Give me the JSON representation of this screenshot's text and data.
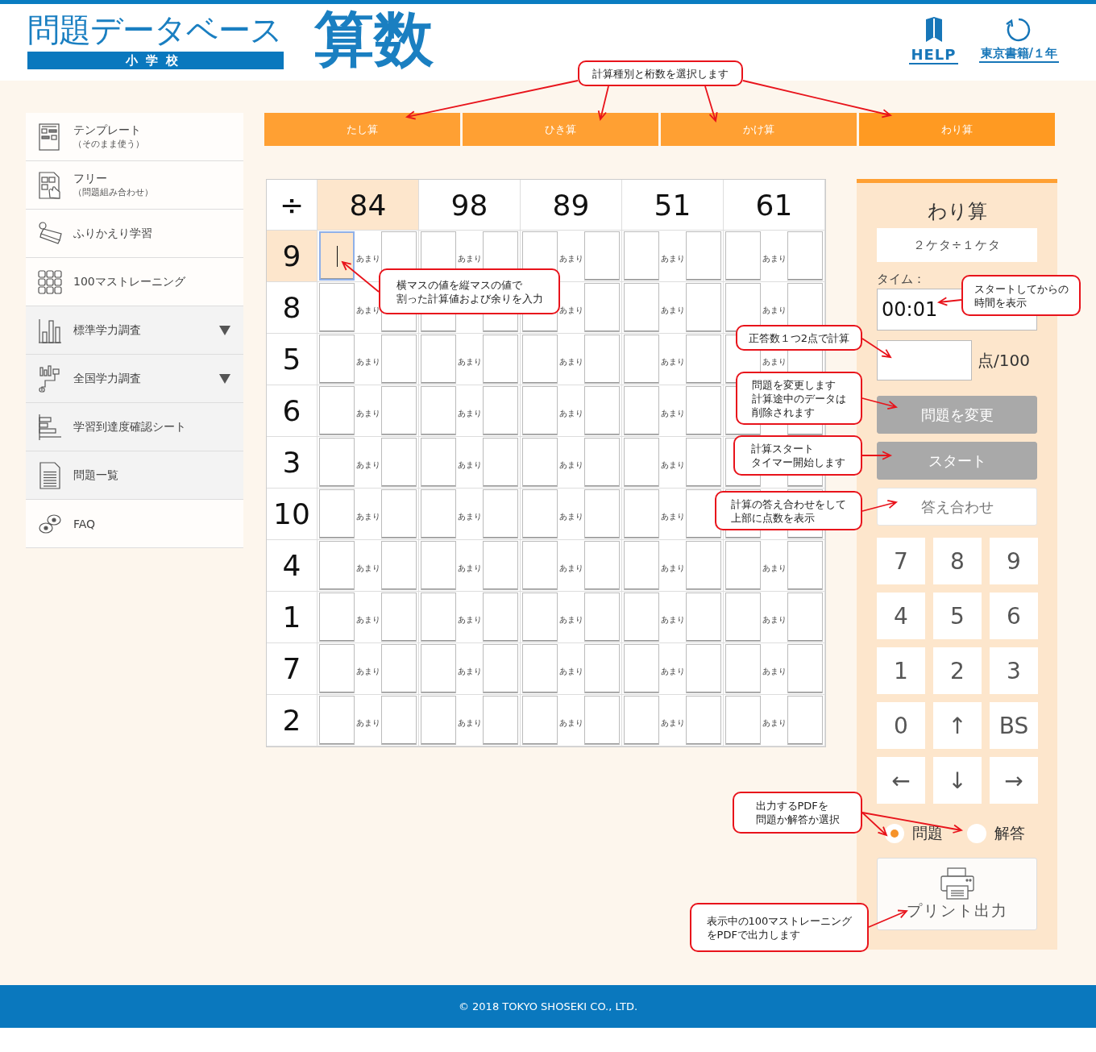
{
  "header": {
    "logo_title": "問題データベース",
    "logo_subtitle": "小学校",
    "subject": "算数",
    "help": {
      "label": "HELP"
    },
    "account": {
      "label": "東京書籍/１年"
    }
  },
  "sidebar": {
    "items": [
      {
        "label": "テンプレート",
        "sublabel": "（そのまま使う）",
        "shaded": false,
        "expandable": false
      },
      {
        "label": "フリー",
        "sublabel": "（問題組み合わせ）",
        "shaded": false,
        "expandable": false
      },
      {
        "label": "ふりかえり学習",
        "shaded": false,
        "expandable": false
      },
      {
        "label": "100マストレーニング",
        "shaded": false,
        "expandable": false
      },
      {
        "label": "標準学力調査",
        "shaded": true,
        "expandable": true
      },
      {
        "label": "全国学力調査",
        "shaded": true,
        "expandable": true
      },
      {
        "label": "学習到達度確認シート",
        "shaded": true,
        "expandable": false
      },
      {
        "label": "問題一覧",
        "shaded": true,
        "expandable": false
      },
      {
        "label": "FAQ",
        "shaded": false,
        "expandable": false
      }
    ]
  },
  "tabs": [
    {
      "label": "たし算",
      "selected": false
    },
    {
      "label": "ひき算",
      "selected": false
    },
    {
      "label": "かけ算",
      "selected": false
    },
    {
      "label": "わり算",
      "selected": true
    }
  ],
  "grid": {
    "operator": "÷",
    "columns": [
      {
        "value": "84",
        "highlighted": true
      },
      {
        "value": "98",
        "highlighted": false
      },
      {
        "value": "89",
        "highlighted": false
      },
      {
        "value": "51",
        "highlighted": false
      },
      {
        "value": "61",
        "highlighted": false
      }
    ],
    "rows": [
      {
        "value": "9",
        "highlighted": true,
        "cells": [
          {
            "selected": true,
            "remainder_label": "あまり"
          },
          {
            "selected": false,
            "remainder_label": "あまり"
          },
          {
            "selected": false,
            "remainder_label": "あまり"
          },
          {
            "selected": false,
            "remainder_label": "あまり"
          },
          {
            "selected": false,
            "remainder_label": "あまり"
          }
        ]
      },
      {
        "value": "8",
        "highlighted": false,
        "cells": [
          {
            "selected": false,
            "remainder_label": "あまり"
          },
          {
            "selected": false
          },
          {
            "selected": false,
            "remainder_label": "あまり"
          },
          {
            "selected": false,
            "remainder_label": "あまり"
          },
          {
            "selected": false,
            "remainder_label": "あまり"
          }
        ]
      },
      {
        "value": "5",
        "highlighted": false,
        "cells": [
          {
            "selected": false,
            "remainder_label": "あまり"
          },
          {
            "selected": false,
            "remainder_label": "あまり"
          },
          {
            "selected": false,
            "remainder_label": "あまり"
          },
          {
            "selected": false,
            "remainder_label": "あまり"
          },
          {
            "selected": false,
            "remainder_label": "あまり"
          }
        ]
      },
      {
        "value": "6",
        "highlighted": false,
        "cells": [
          {
            "selected": false,
            "remainder_label": "あまり"
          },
          {
            "selected": false,
            "remainder_label": "あまり"
          },
          {
            "selected": false,
            "remainder_label": "あまり"
          },
          {
            "selected": false,
            "remainder_label": "あまり"
          },
          {
            "selected": false
          }
        ]
      },
      {
        "value": "3",
        "highlighted": false,
        "cells": [
          {
            "selected": false,
            "remainder_label": "あまり"
          },
          {
            "selected": false,
            "remainder_label": "あまり"
          },
          {
            "selected": false,
            "remainder_label": "あまり"
          },
          {
            "selected": false,
            "remainder_label": "あまり"
          },
          {
            "selected": false
          }
        ]
      },
      {
        "value": "10",
        "highlighted": false,
        "cells": [
          {
            "selected": false,
            "remainder_label": "あまり"
          },
          {
            "selected": false,
            "remainder_label": "あまり"
          },
          {
            "selected": false,
            "remainder_label": "あまり"
          },
          {
            "selected": false,
            "remainder_label": "あまり"
          },
          {
            "selected": false
          }
        ]
      },
      {
        "value": "4",
        "highlighted": false,
        "cells": [
          {
            "selected": false,
            "remainder_label": "あまり"
          },
          {
            "selected": false,
            "remainder_label": "あまり"
          },
          {
            "selected": false,
            "remainder_label": "あまり"
          },
          {
            "selected": false,
            "remainder_label": "あまり"
          },
          {
            "selected": false,
            "remainder_label": "あまり"
          }
        ]
      },
      {
        "value": "1",
        "highlighted": false,
        "cells": [
          {
            "selected": false,
            "remainder_label": "あまり"
          },
          {
            "selected": false,
            "remainder_label": "あまり"
          },
          {
            "selected": false,
            "remainder_label": "あまり"
          },
          {
            "selected": false,
            "remainder_label": "あまり"
          },
          {
            "selected": false,
            "remainder_label": "あまり"
          }
        ]
      },
      {
        "value": "7",
        "highlighted": false,
        "cells": [
          {
            "selected": false,
            "remainder_label": "あまり"
          },
          {
            "selected": false,
            "remainder_label": "あまり"
          },
          {
            "selected": false,
            "remainder_label": "あまり"
          },
          {
            "selected": false,
            "remainder_label": "あまり"
          },
          {
            "selected": false,
            "remainder_label": "あまり"
          }
        ]
      },
      {
        "value": "2",
        "highlighted": false,
        "cells": [
          {
            "selected": false,
            "remainder_label": "あまり"
          },
          {
            "selected": false,
            "remainder_label": "あまり"
          },
          {
            "selected": false,
            "remainder_label": "あまり"
          },
          {
            "selected": false,
            "remainder_label": "あまり"
          },
          {
            "selected": false,
            "remainder_label": "あまり"
          }
        ]
      }
    ]
  },
  "panel": {
    "title": "わり算",
    "level_select": "２ケタ÷１ケタ",
    "time_label": "タイム：",
    "time": "00:01",
    "score_unit": "点/100",
    "buttons": [
      {
        "label": "問題を変更",
        "disabled": true
      },
      {
        "label": "スタート",
        "disabled": true
      },
      {
        "label": "答え合わせ",
        "disabled": false
      }
    ],
    "keypad": [
      "7",
      "8",
      "9",
      "4",
      "5",
      "6",
      "1",
      "2",
      "3",
      "0",
      "↑",
      "BS",
      "←",
      "↓",
      "→"
    ],
    "output": [
      {
        "label": "問題",
        "selected": true
      },
      {
        "label": "解答",
        "selected": false
      }
    ],
    "print_button": {
      "label": "プリント出力"
    }
  },
  "callouts": [
    {
      "lines": [
        "計算種別と桁数を選択します"
      ]
    },
    {
      "lines": [
        "横マスの値を縦マスの値で",
        "割った計算値および余りを入力"
      ]
    },
    {
      "lines": [
        "スタートしてからの",
        "時間を表示"
      ]
    },
    {
      "lines": [
        "正答数１つ2点で計算"
      ]
    },
    {
      "lines": [
        "問題を変更します",
        "計算途中のデータは",
        "削除されます"
      ]
    },
    {
      "lines": [
        "計算スタート",
        "タイマー開始します"
      ]
    },
    {
      "lines": [
        "計算の答え合わせをして",
        "上部に点数を表示"
      ]
    },
    {
      "lines": [
        "出力するPDFを",
        "問題か解答か選択"
      ]
    },
    {
      "lines": [
        "表示中の100マストレーニング",
        "をPDFで出力します"
      ]
    }
  ],
  "footer": {
    "copyright": "© 2018 TOKYO SHOSEKI CO., LTD."
  }
}
